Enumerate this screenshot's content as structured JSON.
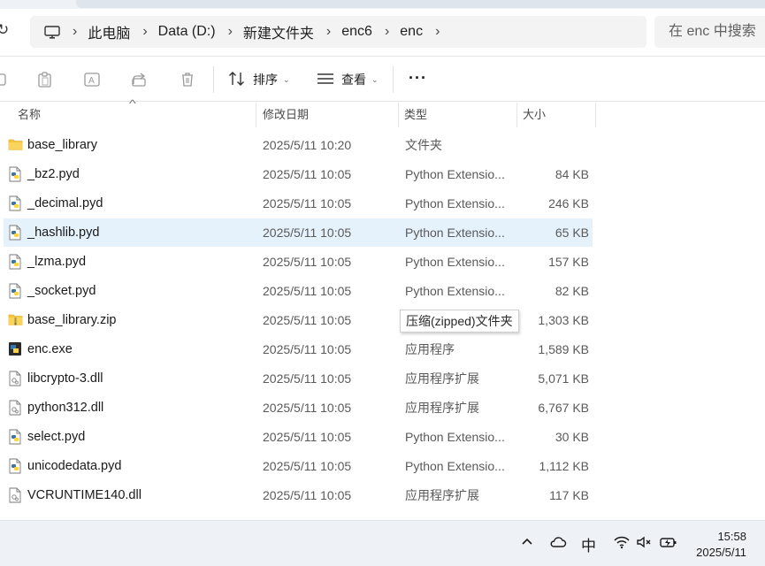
{
  "breadcrumb": {
    "items": [
      "此电脑",
      "Data (D:)",
      "新建文件夹",
      "enc6",
      "enc"
    ]
  },
  "search": {
    "placeholder": "在 enc 中搜索"
  },
  "toolbar": {
    "sort_label": "排序",
    "view_label": "查看",
    "more_label": "···"
  },
  "columns": {
    "name": "名称",
    "date": "修改日期",
    "type": "类型",
    "size": "大小"
  },
  "files": [
    {
      "name": "base_library",
      "date": "2025/5/11 10:20",
      "type": "文件夹",
      "size": "",
      "icon": "folder-icon"
    },
    {
      "name": "_bz2.pyd",
      "date": "2025/5/11 10:05",
      "type": "Python Extensio...",
      "size": "84 KB",
      "icon": "python-file-icon"
    },
    {
      "name": "_decimal.pyd",
      "date": "2025/5/11 10:05",
      "type": "Python Extensio...",
      "size": "246 KB",
      "icon": "python-file-icon"
    },
    {
      "name": "_hashlib.pyd",
      "date": "2025/5/11 10:05",
      "type": "Python Extensio...",
      "size": "65 KB",
      "icon": "python-file-icon"
    },
    {
      "name": "_lzma.pyd",
      "date": "2025/5/11 10:05",
      "type": "Python Extensio...",
      "size": "157 KB",
      "icon": "python-file-icon"
    },
    {
      "name": "_socket.pyd",
      "date": "2025/5/11 10:05",
      "type": "Python Extensio...",
      "size": "82 KB",
      "icon": "python-file-icon"
    },
    {
      "name": "base_library.zip",
      "date": "2025/5/11 10:05",
      "type": "",
      "size": "1,303 KB",
      "icon": "zip-folder-icon"
    },
    {
      "name": "enc.exe",
      "date": "2025/5/11 10:05",
      "type": "应用程序",
      "size": "1,589 KB",
      "icon": "exe-icon"
    },
    {
      "name": "libcrypto-3.dll",
      "date": "2025/5/11 10:05",
      "type": "应用程序扩展",
      "size": "5,071 KB",
      "icon": "dll-icon"
    },
    {
      "name": "python312.dll",
      "date": "2025/5/11 10:05",
      "type": "应用程序扩展",
      "size": "6,767 KB",
      "icon": "dll-icon"
    },
    {
      "name": "select.pyd",
      "date": "2025/5/11 10:05",
      "type": "Python Extensio...",
      "size": "30 KB",
      "icon": "python-file-icon"
    },
    {
      "name": "unicodedata.pyd",
      "date": "2025/5/11 10:05",
      "type": "Python Extensio...",
      "size": "1,112 KB",
      "icon": "python-file-icon"
    },
    {
      "name": "VCRUNTIME140.dll",
      "date": "2025/5/11 10:05",
      "type": "应用程序扩展",
      "size": "117 KB",
      "icon": "dll-icon"
    }
  ],
  "selected_file": "_hashlib.pyd",
  "tooltip": {
    "text": "压缩(zipped)文件夹"
  },
  "taskbar": {
    "ime": "中",
    "time": "15:58",
    "date": "2025/5/11"
  },
  "colors": {
    "selection": "#e5f1fb",
    "folder": "#f4c542",
    "python_blue": "#3776ab",
    "python_yellow": "#ffd343"
  }
}
